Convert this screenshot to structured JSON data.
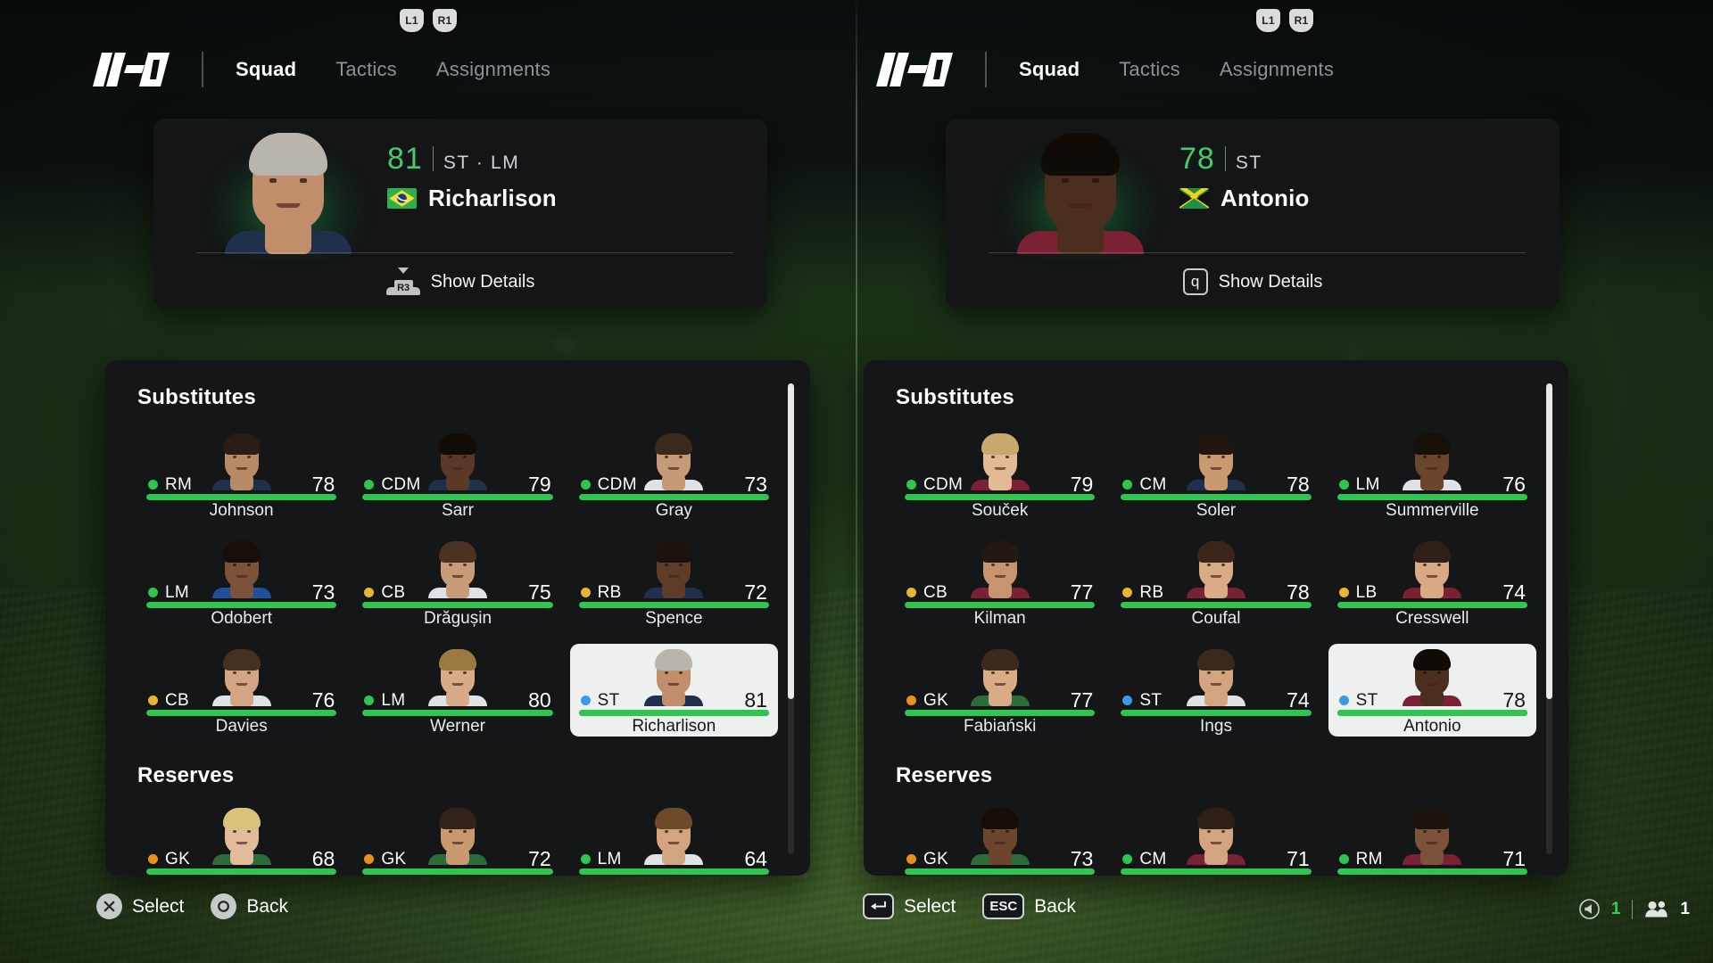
{
  "app": {
    "mode_logo": "KO",
    "split_screen": true
  },
  "panels": [
    {
      "id": "left",
      "shoulder_buttons": [
        "L1",
        "R1"
      ],
      "nav": {
        "tabs": [
          {
            "label": "Squad",
            "active": true
          },
          {
            "label": "Tactics",
            "active": false
          },
          {
            "label": "Assignments",
            "active": false
          }
        ]
      },
      "hero": {
        "rating": "81",
        "positions": "ST · LM",
        "name": "Richarlison",
        "nation": "Brazil",
        "flag_colors": {
          "field": "#2fae4b",
          "diamond": "#f7e233",
          "circle": "#1b3a8c"
        },
        "action_label": "Show Details",
        "action_button": "R3",
        "action_button_type": "stick"
      },
      "sections": [
        {
          "title": "Substitutes"
        },
        {
          "title": "Reserves"
        }
      ],
      "substitutes": [
        {
          "pos": "RM",
          "pos_color": "#2fc64f",
          "rating": "78",
          "name": "Johnson",
          "bar": 100,
          "selected": false,
          "skin": "#b98a68",
          "hair": "#2a1d16",
          "kit": "#20304c"
        },
        {
          "pos": "CDM",
          "pos_color": "#2fc64f",
          "rating": "79",
          "name": "Sarr",
          "bar": 100,
          "selected": false,
          "skin": "#5a3a26",
          "hair": "#120c09",
          "kit": "#20304c"
        },
        {
          "pos": "CDM",
          "pos_color": "#2fc64f",
          "rating": "73",
          "name": "Gray",
          "bar": 100,
          "selected": false,
          "skin": "#c79a77",
          "hair": "#3a2a1c",
          "kit": "#dfe3e6"
        },
        {
          "pos": "LM",
          "pos_color": "#2fc64f",
          "rating": "73",
          "name": "Odobert",
          "bar": 100,
          "selected": false,
          "skin": "#7d523a",
          "hair": "#171009",
          "kit": "#20509c"
        },
        {
          "pos": "CB",
          "pos_color": "#e8b431",
          "rating": "75",
          "name": "Drăgușin",
          "bar": 100,
          "selected": false,
          "skin": "#c99c79",
          "hair": "#4a3322",
          "kit": "#dfe3e6"
        },
        {
          "pos": "RB",
          "pos_color": "#e8b431",
          "rating": "72",
          "name": "Spence",
          "bar": 100,
          "selected": false,
          "skin": "#5e3c27",
          "hair": "#1a120c",
          "kit": "#20304c"
        },
        {
          "pos": "CB",
          "pos_color": "#e8b431",
          "rating": "76",
          "name": "Davies",
          "bar": 100,
          "selected": false,
          "skin": "#d3a583",
          "hair": "#46301f",
          "kit": "#dfe3e6"
        },
        {
          "pos": "LM",
          "pos_color": "#2fc64f",
          "rating": "80",
          "name": "Werner",
          "bar": 100,
          "selected": false,
          "skin": "#d8ab88",
          "hair": "#9b7a42",
          "kit": "#dfe3e6"
        },
        {
          "pos": "ST",
          "pos_color": "#3b9ae8",
          "rating": "81",
          "name": "Richarlison",
          "bar": 100,
          "selected": true,
          "skin": "#c08e6a",
          "hair": "#b9b4ad",
          "kit": "#20304c"
        }
      ],
      "reserves": [
        {
          "pos": "GK",
          "pos_color": "#e8901f",
          "rating": "68",
          "name": "",
          "bar": 100,
          "selected": false,
          "skin": "#e2bb99",
          "hair": "#d9c27a",
          "kit": "#2c6b3a"
        },
        {
          "pos": "GK",
          "pos_color": "#e8901f",
          "rating": "72",
          "name": "",
          "bar": 100,
          "selected": false,
          "skin": "#c9996f",
          "hair": "#32231a",
          "kit": "#2c6b3a"
        },
        {
          "pos": "LM",
          "pos_color": "#2fc64f",
          "rating": "64",
          "name": "",
          "bar": 100,
          "selected": false,
          "skin": "#d2a47f",
          "hair": "#6d4a28",
          "kit": "#dfe3e6"
        }
      ],
      "scroll": {
        "thumb_pct": 67
      },
      "hints": [
        {
          "glyph": "cross",
          "label": "Select"
        },
        {
          "glyph": "circle",
          "label": "Back"
        }
      ]
    },
    {
      "id": "right",
      "shoulder_buttons": [
        "L1",
        "R1"
      ],
      "nav": {
        "tabs": [
          {
            "label": "Squad",
            "active": true
          },
          {
            "label": "Tactics",
            "active": false
          },
          {
            "label": "Assignments",
            "active": false
          }
        ]
      },
      "hero": {
        "rating": "78",
        "positions": "ST",
        "name": "Antonio",
        "nation": "Jamaica",
        "flag_colors": {
          "field": "#1b9141",
          "diamond": "#f5d016",
          "circle": "#111111"
        },
        "action_label": "Show Details",
        "action_button": "q",
        "action_button_type": "key"
      },
      "sections": [
        {
          "title": "Substitutes"
        },
        {
          "title": "Reserves"
        }
      ],
      "substitutes": [
        {
          "pos": "CDM",
          "pos_color": "#2fc64f",
          "rating": "79",
          "name": "Souček",
          "bar": 100,
          "selected": false,
          "skin": "#e0bb96",
          "hair": "#c9a86b",
          "kit": "#7a2233"
        },
        {
          "pos": "CM",
          "pos_color": "#2fc64f",
          "rating": "78",
          "name": "Soler",
          "bar": 100,
          "selected": false,
          "skin": "#c9996f",
          "hair": "#201510",
          "kit": "#20304c"
        },
        {
          "pos": "LM",
          "pos_color": "#2fc64f",
          "rating": "76",
          "name": "Summerville",
          "bar": 100,
          "selected": false,
          "skin": "#6b452c",
          "hair": "#171009",
          "kit": "#dfe3e6"
        },
        {
          "pos": "CB",
          "pos_color": "#e8b431",
          "rating": "77",
          "name": "Kilman",
          "bar": 100,
          "selected": false,
          "skin": "#c79471",
          "hair": "#241812",
          "kit": "#7a2233"
        },
        {
          "pos": "RB",
          "pos_color": "#e8b431",
          "rating": "78",
          "name": "Coufal",
          "bar": 100,
          "selected": false,
          "skin": "#d9ab86",
          "hair": "#3a2618",
          "kit": "#7a2233"
        },
        {
          "pos": "LB",
          "pos_color": "#e8b431",
          "rating": "74",
          "name": "Cresswell",
          "bar": 100,
          "selected": false,
          "skin": "#d7aa85",
          "hair": "#2e2017",
          "kit": "#7a2233"
        },
        {
          "pos": "GK",
          "pos_color": "#e8901f",
          "rating": "77",
          "name": "Fabiański",
          "bar": 100,
          "selected": false,
          "skin": "#d9ab86",
          "hair": "#3c2a1d",
          "kit": "#2c6b3a"
        },
        {
          "pos": "ST",
          "pos_color": "#3b9ae8",
          "rating": "74",
          "name": "Ings",
          "bar": 100,
          "selected": false,
          "skin": "#d2a47f",
          "hair": "#3a2a1d",
          "kit": "#dfe3e6"
        },
        {
          "pos": "ST",
          "pos_color": "#3b9ae8",
          "rating": "78",
          "name": "Antonio",
          "bar": 100,
          "selected": true,
          "skin": "#4b2e1d",
          "hair": "#110b07",
          "kit": "#7a2233"
        }
      ],
      "reserves": [
        {
          "pos": "GK",
          "pos_color": "#e8901f",
          "rating": "73",
          "name": "",
          "bar": 100,
          "selected": false,
          "skin": "#6b452c",
          "hair": "#140d08",
          "kit": "#2c6b3a"
        },
        {
          "pos": "CM",
          "pos_color": "#2fc64f",
          "rating": "71",
          "name": "",
          "bar": 100,
          "selected": false,
          "skin": "#d2a47f",
          "hair": "#2e2017",
          "kit": "#7a2233"
        },
        {
          "pos": "RM",
          "pos_color": "#2fc64f",
          "rating": "71",
          "name": "",
          "bar": 100,
          "selected": false,
          "skin": "#7d523a",
          "hair": "#1a120c",
          "kit": "#7a2233"
        }
      ],
      "scroll": {
        "thumb_pct": 67
      },
      "hints": [
        {
          "glyph": "enter",
          "label": "Select"
        },
        {
          "glyph": "esc",
          "label": "Back"
        }
      ]
    }
  ],
  "status": {
    "volume_count": "1",
    "players_count": "1",
    "volume_color": "#2fd24f"
  },
  "colors": {
    "accent_green": "#2fc64f",
    "rating_green": "#49c96d",
    "pos_attack": "#3b9ae8",
    "pos_mid": "#2fc64f",
    "pos_def": "#e8b431",
    "pos_gk": "#e8901f",
    "panel_bg": "#141617",
    "card_bg": "#131516",
    "selected_bg": "#eef0ef"
  }
}
